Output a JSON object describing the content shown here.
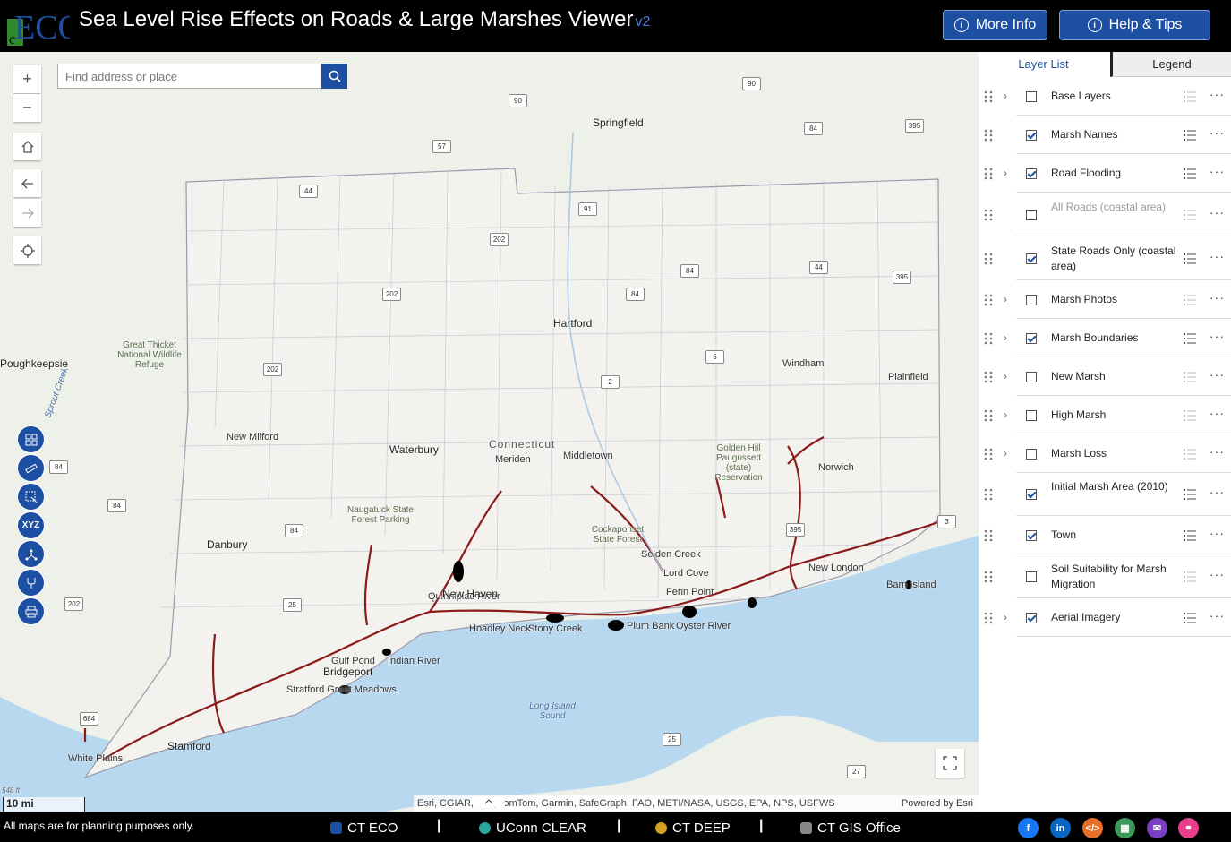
{
  "header": {
    "title": "Sea Level Rise Effects on Roads & Large Marshes Viewer",
    "version": "v2",
    "logo_text": "ECO",
    "more_info_label": "More Info",
    "help_label": "Help & Tips"
  },
  "search": {
    "placeholder": "Find address or place"
  },
  "map_controls": {
    "zoom_in": "+",
    "zoom_out": "−"
  },
  "tools": {
    "xyz_label": "XYZ"
  },
  "map_labels": {
    "springfield": "Springfield",
    "hartford": "Hartford",
    "poughkeepsie": "Poughkeepsie",
    "great_thicket": "Great Thicket National Wildlife Refuge",
    "windham": "Windham",
    "plainfield": "Plainfield",
    "new_milford": "New Milford",
    "waterbury": "Waterbury",
    "connecticut": "Connecticut",
    "meriden": "Meriden",
    "middletown": "Middletown",
    "golden_hill": "Golden Hill Paugussett (state) Reservation",
    "norwich": "Norwich",
    "naugatuck": "Naugatuck State Forest Parking",
    "danbury": "Danbury",
    "cockaponset": "Cockaponset State Forest",
    "selden_creek": "Selden Creek",
    "lord_cove": "Lord Cove",
    "new_london": "New London",
    "barn_island": "Barn Island",
    "quinnipiac": "Quinnipiac River",
    "new_haven": "New Haven",
    "hoadley_neck": "Hoadley Neck",
    "stony_creek": "Stony Creek",
    "plum_bank": "Plum Bank",
    "oyster_river": "Oyster River",
    "fenn_point": "Fenn Point",
    "gulf_pond": "Gulf Pond",
    "indian_river": "Indian River",
    "bridgeport": "Bridgeport",
    "stratford": "Stratford Great Meadows",
    "long_island_sound": "Long Island Sound",
    "stamford": "Stamford",
    "white_plains": "White Plains",
    "sprout_creek": "Sprout Creek"
  },
  "route_shields": [
    "90",
    "90",
    "57",
    "84",
    "395",
    "44",
    "91",
    "202",
    "84",
    "44",
    "395",
    "202",
    "84",
    "202",
    "6",
    "2",
    "84",
    "84",
    "84",
    "202",
    "25",
    "684",
    "395",
    "3",
    "25",
    "27"
  ],
  "attribution": {
    "text": "Esri, CGIAR, Esri, TomTom, Garmin, SafeGraph, FAO, METI/NASA, USGS, EPA, NPS, USFWS",
    "powered": "Powered by Esri"
  },
  "scale": {
    "label": "10 mi",
    "elev": "548 ft"
  },
  "panel": {
    "tabs": [
      "Layer List",
      "Legend"
    ],
    "layers": [
      {
        "name": "Base Layers",
        "checked": false,
        "expandable": true,
        "dim": false
      },
      {
        "name": "Marsh Names",
        "checked": true,
        "expandable": false,
        "dim": false
      },
      {
        "name": "Road Flooding",
        "checked": true,
        "expandable": true,
        "dim": false
      },
      {
        "name": "All Roads (coastal area)",
        "checked": false,
        "expandable": false,
        "dim": true
      },
      {
        "name": "State Roads Only (coastal area)",
        "checked": true,
        "expandable": false,
        "dim": false
      },
      {
        "name": "Marsh Photos",
        "checked": false,
        "expandable": true,
        "dim": false
      },
      {
        "name": "Marsh Boundaries",
        "checked": true,
        "expandable": true,
        "dim": false
      },
      {
        "name": "New Marsh",
        "checked": false,
        "expandable": true,
        "dim": false
      },
      {
        "name": "High Marsh",
        "checked": false,
        "expandable": true,
        "dim": false
      },
      {
        "name": "Marsh Loss",
        "checked": false,
        "expandable": true,
        "dim": false
      },
      {
        "name": "Initial Marsh Area (2010)",
        "checked": true,
        "expandable": false,
        "dim": false
      },
      {
        "name": "Town",
        "checked": true,
        "expandable": false,
        "dim": false
      },
      {
        "name": "Soil Suitability for Marsh Migration",
        "checked": false,
        "expandable": false,
        "dim": false
      },
      {
        "name": "Aerial Imagery",
        "checked": true,
        "expandable": true,
        "dim": false
      }
    ]
  },
  "footer": {
    "note": "All maps are for planning purposes only.",
    "links": [
      "CT ECO",
      "UConn CLEAR",
      "CT DEEP",
      "CT GIS Office"
    ],
    "separator": "|",
    "social": [
      "facebook-icon",
      "linkedin-icon",
      "code-icon",
      "qr-icon",
      "email-icon",
      "link-icon"
    ]
  },
  "colors": {
    "accent": "#1d4fa3",
    "road_flood": "#8b1a1a",
    "water": "#b8d8f0"
  }
}
